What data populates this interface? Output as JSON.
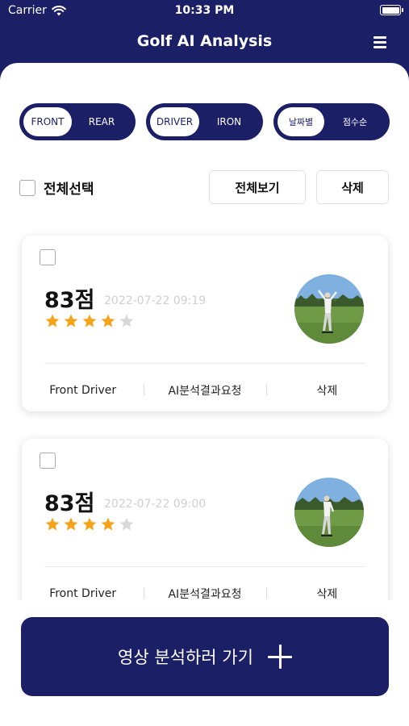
{
  "status_bar": {
    "carrier": "Carrier",
    "time": "10:33 PM"
  },
  "header": {
    "title": "Golf AI Analysis"
  },
  "filters": {
    "view": {
      "options": [
        "FRONT",
        "REAR"
      ],
      "selected": "FRONT"
    },
    "club": {
      "options": [
        "DRIVER",
        "IRON"
      ],
      "selected": "DRIVER"
    },
    "sort": {
      "options": [
        "날짜별",
        "점수순"
      ],
      "selected": "날짜별"
    }
  },
  "toolbar": {
    "select_all_label": "전체선택",
    "view_all_label": "전체보기",
    "delete_label": "삭제"
  },
  "cards": [
    {
      "score": "83점",
      "date": "2022-07-22 09:19",
      "rating": 4,
      "max_rating": 5,
      "actions": [
        "Front Driver",
        "AI분석결과요청",
        "삭제"
      ]
    },
    {
      "score": "83점",
      "date": "2022-07-22 09:00",
      "rating": 4,
      "max_rating": 5,
      "actions": [
        "Front Driver",
        "AI분석결과요청",
        "삭제"
      ]
    }
  ],
  "cta": {
    "label": "영상 분석하러 가기"
  },
  "colors": {
    "primary": "#1b1f66",
    "star_on": "#f5a31a",
    "star_off": "#d9d9d9"
  }
}
